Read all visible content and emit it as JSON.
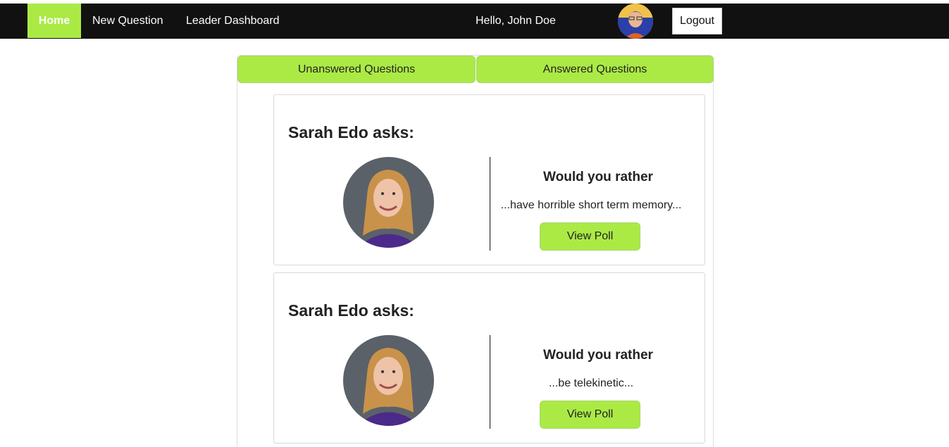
{
  "nav": {
    "home_label": "Home",
    "new_question_label": "New Question",
    "leader_dashboard_label": "Leader Dashboard",
    "greeting": "Hello, John Doe",
    "logout_label": "Logout"
  },
  "tabs": {
    "unanswered_label": "Unanswered Questions",
    "answered_label": "Answered Questions"
  },
  "questions": [
    {
      "author_heading": "Sarah Edo asks:",
      "prompt": "Would you rather",
      "option_preview": "...have horrible short term memory...",
      "button_label": "View Poll"
    },
    {
      "author_heading": "Sarah Edo asks:",
      "prompt": "Would you rather",
      "option_preview": "...be telekinetic...",
      "button_label": "View Poll"
    }
  ],
  "colors": {
    "accent": "#abea45",
    "navbar": "#111111"
  }
}
